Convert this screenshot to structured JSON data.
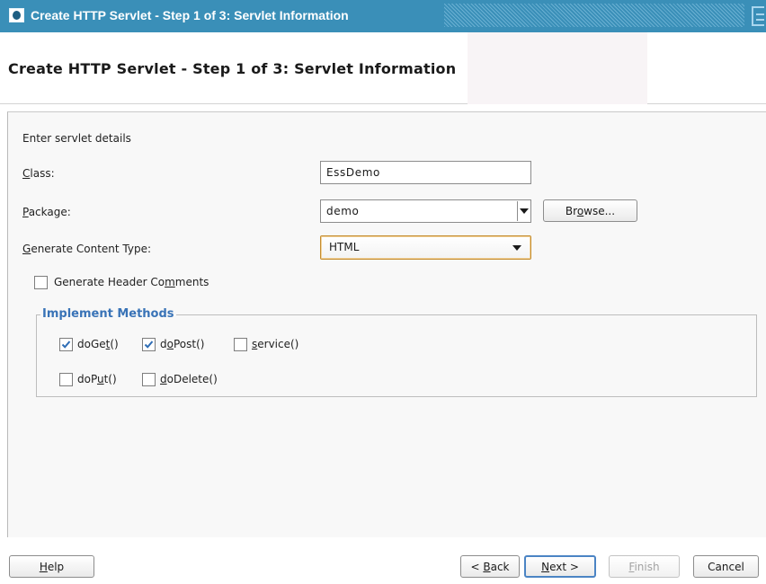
{
  "window": {
    "title": "Create HTTP Servlet - Step 1 of 3: Servlet Information",
    "icon": "window-icon"
  },
  "header": {
    "heading": "Create HTTP Servlet - Step 1 of 3: Servlet Information"
  },
  "form": {
    "intro": "Enter servlet details",
    "class_label": {
      "mnemonic": "C",
      "rest": "lass:"
    },
    "class_value": "EssDemo",
    "package_label": {
      "mnemonic": "P",
      "rest": "ackage:"
    },
    "package_value": "demo",
    "browse_button": {
      "before": "Br",
      "mnemonic": "o",
      "after": "wse..."
    },
    "content_type_label": {
      "mnemonic": "G",
      "rest": "enerate Content Type:"
    },
    "content_type_value": "HTML",
    "header_comments": {
      "before": "Generate Header Co",
      "mnemonic": "m",
      "after": "ments",
      "checked": false
    }
  },
  "implement_methods": {
    "legend": "Implement Methods",
    "methods": [
      {
        "before": "doGe",
        "mnemonic": "t",
        "after": "()",
        "checked": true
      },
      {
        "before": "d",
        "mnemonic": "o",
        "after": "Post()",
        "checked": true
      },
      {
        "before": "",
        "mnemonic": "s",
        "after": "ervice()",
        "checked": false
      },
      {
        "before": "doP",
        "mnemonic": "u",
        "after": "t()",
        "checked": false
      },
      {
        "before": "",
        "mnemonic": "d",
        "after": "oDelete()",
        "checked": false
      }
    ]
  },
  "footer": {
    "help": {
      "mnemonic": "H",
      "rest": "elp"
    },
    "back": {
      "before": "< ",
      "mnemonic": "B",
      "after": "ack"
    },
    "next": {
      "mnemonic": "N",
      "after": "ext >"
    },
    "finish": {
      "mnemonic": "F",
      "after": "inish",
      "enabled": false
    },
    "cancel": "Cancel"
  },
  "colors": {
    "titlebar": "#3a8fb8",
    "group_legend": "#3973b7",
    "default_button_border": "#4b84c4",
    "focused_choice_border": "#c48c2e"
  }
}
